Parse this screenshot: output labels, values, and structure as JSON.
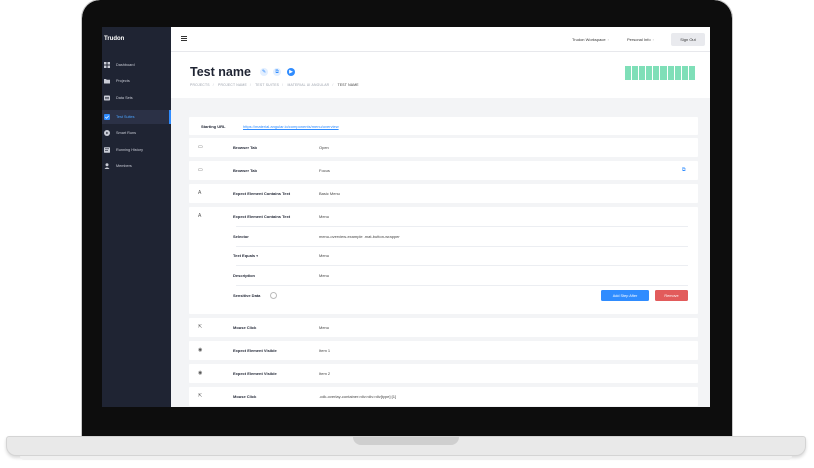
{
  "app": {
    "brand": "Trudon"
  },
  "sidebar": {
    "items": [
      {
        "label": "Dashboard",
        "icon": "grid-icon"
      },
      {
        "label": "Projects",
        "icon": "folder-icon"
      },
      {
        "label": "Data Sets",
        "icon": "database-icon"
      },
      {
        "label": "Test Suites",
        "icon": "checklist-icon",
        "active": true
      },
      {
        "label": "Smart Runs",
        "icon": "play-circle-icon"
      },
      {
        "label": "Running History",
        "icon": "history-icon"
      },
      {
        "label": "Members",
        "icon": "user-icon"
      }
    ]
  },
  "topbar": {
    "workspace": "Trudon Workspace",
    "personal": "Personal Info",
    "signout": "Sign Out"
  },
  "header": {
    "title": "Test name",
    "breadcrumb": [
      "PROJECTS",
      "PROJECT NAME",
      "TEST SUITES",
      "MATERIAL UI ANGULAR",
      "TEST NAME"
    ]
  },
  "starting": {
    "label": "Starting URL",
    "url": "https://material.angular.io/components/menu/overview"
  },
  "steps": [
    {
      "action": "Browser Tab",
      "value": "Open",
      "icon": "window-icon"
    },
    {
      "action": "Browser Tab",
      "value": "Focus",
      "icon": "window-icon"
    },
    {
      "action": "Expect Element Contains Text",
      "value": "Basic Menu",
      "icon": "text-icon"
    },
    {
      "action": "Expect Element Contains Text",
      "value": "Menu",
      "icon": "text-icon"
    },
    {
      "action": "Mouse Click",
      "value": "Menu",
      "icon": "cursor-icon"
    },
    {
      "action": "Expect Element Visible",
      "value": "Item 1",
      "icon": "eye-icon"
    },
    {
      "action": "Expect Element Visible",
      "value": "Item 2",
      "icon": "eye-icon"
    },
    {
      "action": "Mouse Click",
      "value": ".cdk-overlay-container>div>div>div[type]:[1]",
      "icon": "cursor-icon"
    }
  ],
  "expanded": {
    "fields": [
      {
        "label": "Selector",
        "value": "menu-overview-example .mat-button-wrapper"
      },
      {
        "label": "Text Equals",
        "value": "Menu"
      },
      {
        "label": "Description",
        "value": "Menu"
      }
    ],
    "sensitive_label": "Sensitive Data",
    "add_step": "Add Step After",
    "remove": "Remove"
  },
  "colors": {
    "primary": "#2f8cff",
    "danger": "#e25b5b",
    "sidebar": "#1f2433",
    "status": "#7fdfb8"
  }
}
